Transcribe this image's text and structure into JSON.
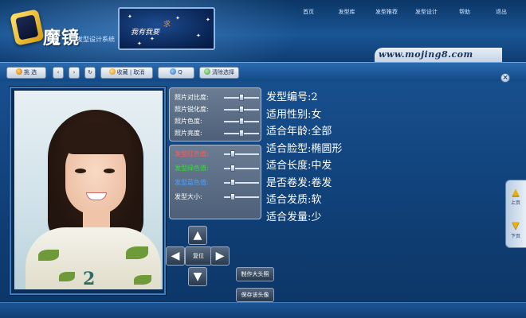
{
  "brand": {
    "name": "魔镜",
    "subtitle": "发型设计系统"
  },
  "banner": {
    "title": "我有我要",
    "accent": "求"
  },
  "topnav": [
    {
      "label": "首页"
    },
    {
      "label": "发型库"
    },
    {
      "label": "发型推荐"
    },
    {
      "label": "发型设计"
    },
    {
      "label": "帮助"
    },
    {
      "label": "退出"
    }
  ],
  "site_url": "www.mojing8.com",
  "toolbar": {
    "select": "挑 选",
    "collect": "收藏 | 取消",
    "search": "Q",
    "clear": "清除选择"
  },
  "photo": {
    "number": "2"
  },
  "adjust_photo": {
    "contrast": "照片对比度:",
    "sharpness": "照片锐化度:",
    "hue": "照片色度:",
    "brightness": "照片亮度:"
  },
  "adjust_hair": {
    "red": "发型红色值:",
    "green": "发型绿色值:",
    "blue": "发型蓝色值:",
    "size": "发型大小:"
  },
  "slider_levels": {
    "contrast": 0.5,
    "sharpness": 0.5,
    "hue": 0.5,
    "brightness": 0.5,
    "red": 0.2,
    "green": 0.2,
    "blue": 0.2,
    "size": 0.2
  },
  "pad": {
    "reset": "复位"
  },
  "actions": {
    "make_big_photo": "制作大头照",
    "save_photo": "保存该头像"
  },
  "info": {
    "code": "发型编号:2",
    "gender": "适用性别:女",
    "age": "适合年龄:全部",
    "face": "适合脸型:椭圆形",
    "length": "适合长度:中发",
    "curl": "是否卷发:卷发",
    "quality": "适合发质:软",
    "amount": "适合发量:少"
  },
  "pager": {
    "prev": "上页",
    "next": "下页"
  },
  "colors": {
    "hair_red_label": "#ff5a5a",
    "hair_green_label": "#33dd33",
    "hair_blue_label": "#4aa0ff",
    "text": "#ffffff"
  }
}
